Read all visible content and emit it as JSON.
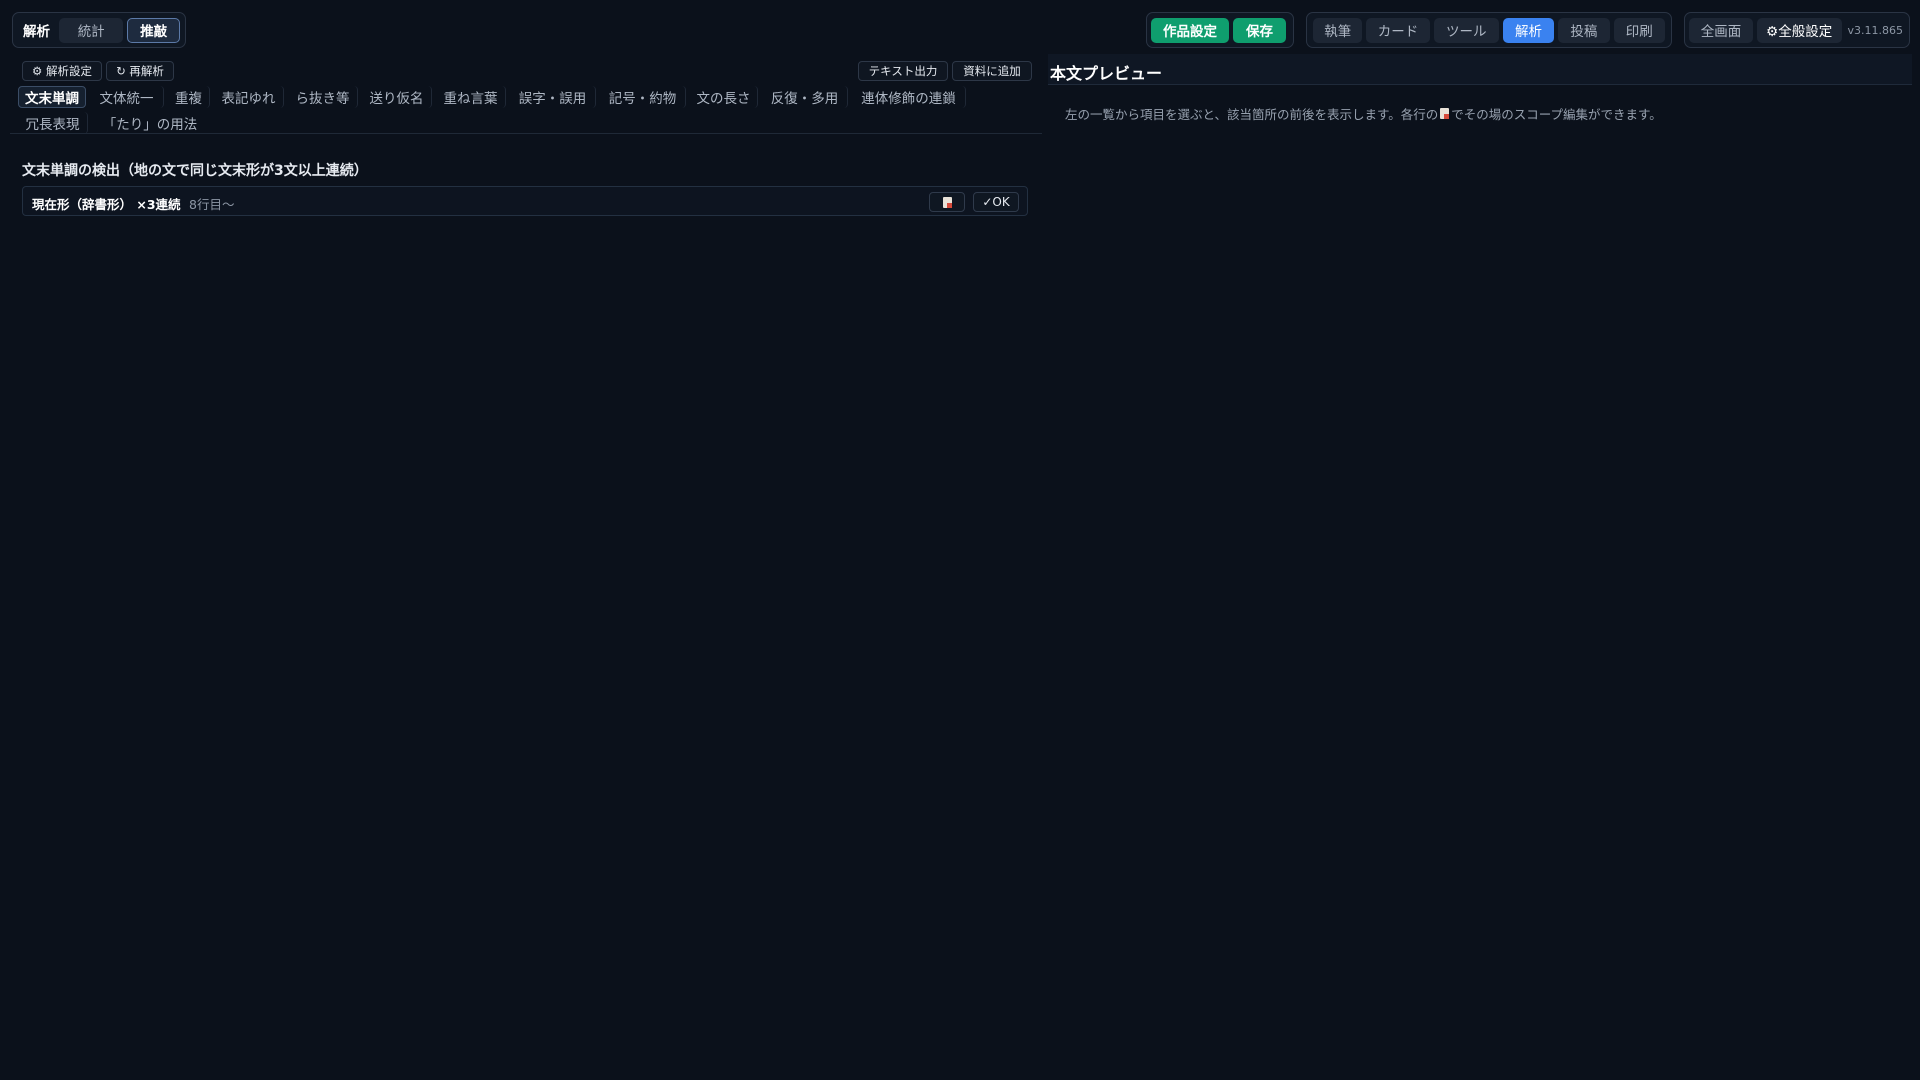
{
  "mode_tabs": [
    {
      "label": "解析",
      "style": "plain-bold"
    },
    {
      "label": "統計",
      "style": "gray"
    },
    {
      "label": "推敲",
      "style": "active-outline"
    }
  ],
  "project": {
    "settings_label": "作品設定",
    "save_label": "保存"
  },
  "views": [
    {
      "label": "執筆",
      "active": false
    },
    {
      "label": "カード",
      "active": false
    },
    {
      "label": "ツール",
      "active": false
    },
    {
      "label": "解析",
      "active": true
    },
    {
      "label": "投稿",
      "active": false
    },
    {
      "label": "印刷",
      "active": false
    }
  ],
  "global": {
    "fullscreen_label": "全画面",
    "settings_label": "⚙全般設定",
    "version": "v3.11.865"
  },
  "toolbar": {
    "analysis_settings": "⚙ 解析設定",
    "reanalyze": "↻ 再解析",
    "text_export": "テキスト出力",
    "add_to_materials": "資料に追加"
  },
  "tabs": [
    {
      "label": "文末単調",
      "active": true
    },
    {
      "label": "文体統一"
    },
    {
      "label": "重複"
    },
    {
      "label": "表記ゆれ"
    },
    {
      "label": "ら抜き等"
    },
    {
      "label": "送り仮名"
    },
    {
      "label": "重ね言葉"
    },
    {
      "label": "誤字・誤用"
    },
    {
      "label": "記号・約物"
    },
    {
      "label": "文の長さ"
    },
    {
      "label": "反復・多用"
    },
    {
      "label": "連体修飾の連鎖"
    },
    {
      "label": "冗長表現"
    },
    {
      "label": "「たり」の用法"
    }
  ],
  "section": {
    "title": "文末単調の検出（地の文で同じ文末形が3文以上連続）"
  },
  "results": [
    {
      "title": "現在形（辞書形） ×3連続",
      "meta": "8行目〜",
      "ok_label": "✓OK"
    }
  ],
  "preview": {
    "title": "本文プレビュー",
    "hint_before": "左の一覧から項目を選ぶと、該当箇所の前後を表示します。各行の",
    "hint_after": "でその場のスコープ編集ができます。"
  },
  "colors": {
    "background": "#0b111b",
    "accent_green": "#0f9e6e",
    "accent_blue": "#3a82f0"
  },
  "icons": {
    "scope_edit": "document-icon"
  }
}
